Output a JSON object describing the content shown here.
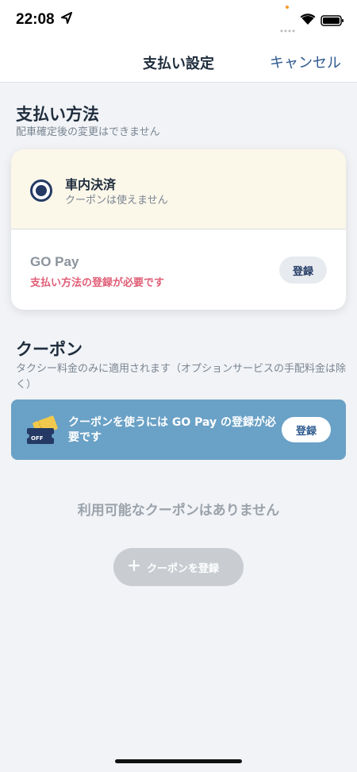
{
  "status_bar": {
    "time": "22:08"
  },
  "nav": {
    "title": "支払い設定",
    "cancel_label": "キャンセル"
  },
  "payment_section": {
    "title": "支払い方法",
    "subtitle": "配車確定後の変更はできません",
    "options": [
      {
        "label": "車内決済",
        "sublabel": "クーポンは使えません",
        "selected": true
      },
      {
        "label": "GO Pay",
        "sublabel": "支払い方法の登録が必要です",
        "button_label": "登録",
        "selected": false
      }
    ]
  },
  "coupon_section": {
    "title": "クーポン",
    "subtitle": "タクシー料金のみに適用されます（オプションサービスの手配料金は除く）",
    "banner": {
      "icon_text": "OFF",
      "text": "クーポンを使うには GO Pay の登録が必要です",
      "button_label": "登録",
      "color": "#6aa1c6"
    },
    "empty_text": "利用可能なクーポンはありません",
    "add_button_label": "クーポンを登録"
  },
  "colors": {
    "accent": "#243a64",
    "warning": "#e05d76",
    "selected_bg": "#fbf7e9"
  }
}
